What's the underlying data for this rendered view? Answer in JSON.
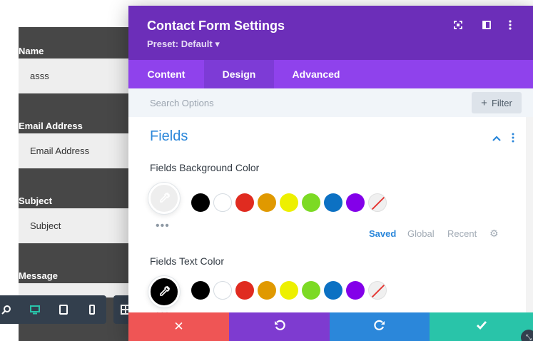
{
  "background_form": {
    "fields": [
      {
        "label": "Name",
        "value": "asss"
      },
      {
        "label": "Email Address",
        "value": "Email Address"
      },
      {
        "label": "Subject",
        "value": "Subject"
      },
      {
        "label": "Message",
        "value": ""
      }
    ]
  },
  "view_bar": {
    "icons": [
      "zoom-icon",
      "desktop-icon",
      "tablet-icon",
      "phone-icon",
      "grid-icon"
    ]
  },
  "modal": {
    "title": "Contact Form Settings",
    "preset": "Preset: Default ▾",
    "tabs": [
      {
        "label": "Content",
        "active": false
      },
      {
        "label": "Design",
        "active": true
      },
      {
        "label": "Advanced",
        "active": false
      }
    ],
    "search": {
      "placeholder": "Search Options"
    },
    "filter_label": "Filter",
    "section": {
      "title": "Fields"
    },
    "options": [
      {
        "label": "Fields Background Color",
        "picker_color": "#eeeeee"
      },
      {
        "label": "Fields Text Color",
        "picker_color": "#000000"
      }
    ],
    "palette": {
      "colors": [
        "#000000",
        "#ffffff",
        "#e02b20",
        "#e09900",
        "#edf000",
        "#7cda24",
        "#0c71c3",
        "#8300e9"
      ],
      "tabs": [
        "Saved",
        "Global",
        "Recent"
      ],
      "active_tab": "Saved"
    },
    "footer": {
      "colors": {
        "discard": "#ef5555",
        "undo": "#7e3bd0",
        "redo": "#2b87da",
        "save": "#29c4a9"
      }
    }
  },
  "colors": {
    "header": "#6c2eb9",
    "tabs_bar": "#8f42ec",
    "accent": "#2b87da"
  }
}
